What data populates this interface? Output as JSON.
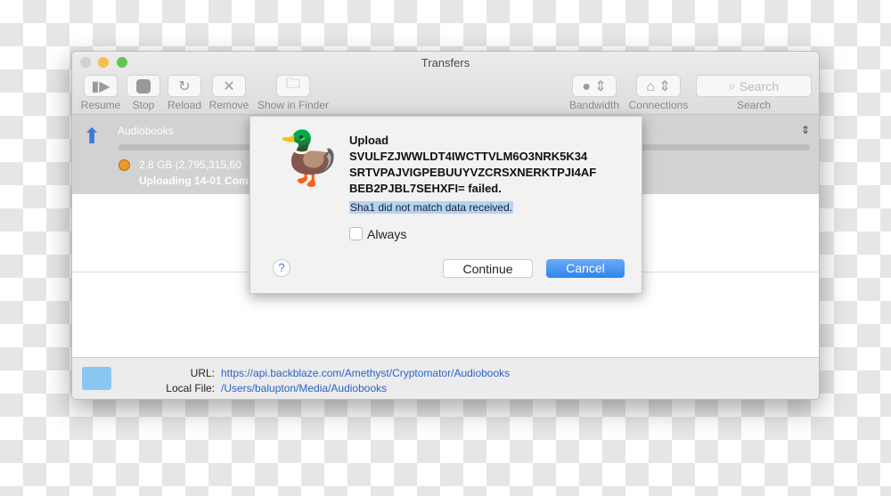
{
  "window": {
    "title": "Transfers"
  },
  "toolbar": {
    "resume": "Resume",
    "stop": "Stop",
    "reload": "Reload",
    "remove": "Remove",
    "show_in_finder": "Show in Finder",
    "bandwidth": "Bandwidth",
    "connections": "Connections",
    "search_label": "Search",
    "search_placeholder": "Search"
  },
  "transfer": {
    "name": "Audiobooks",
    "size": "2.8 GB (2,795,315,60",
    "status": "Uploading 14-01 Com"
  },
  "bottom": {
    "url_label": "URL:",
    "url": "https://api.backblaze.com/Amethyst/Cryptomator/Audiobooks",
    "local_label": "Local File:",
    "local": "/Users/balupton/Media/Audiobooks"
  },
  "dialog": {
    "line1": "Upload",
    "line2": "SVULFZJWWLDT4IWCTTVLM6O3NRK5K34",
    "line3": "SRTVPAJVIGPEBUUYVZCRSXNERKTPJI4AF",
    "line4": "BEB2PJBL7SEHXFI= failed.",
    "detail": "Sha1 did not match data received.",
    "always": "Always",
    "continue": "Continue",
    "cancel": "Cancel",
    "help": "?"
  },
  "colors": {
    "accent": "#4a90f0",
    "link": "#2a63c8"
  }
}
